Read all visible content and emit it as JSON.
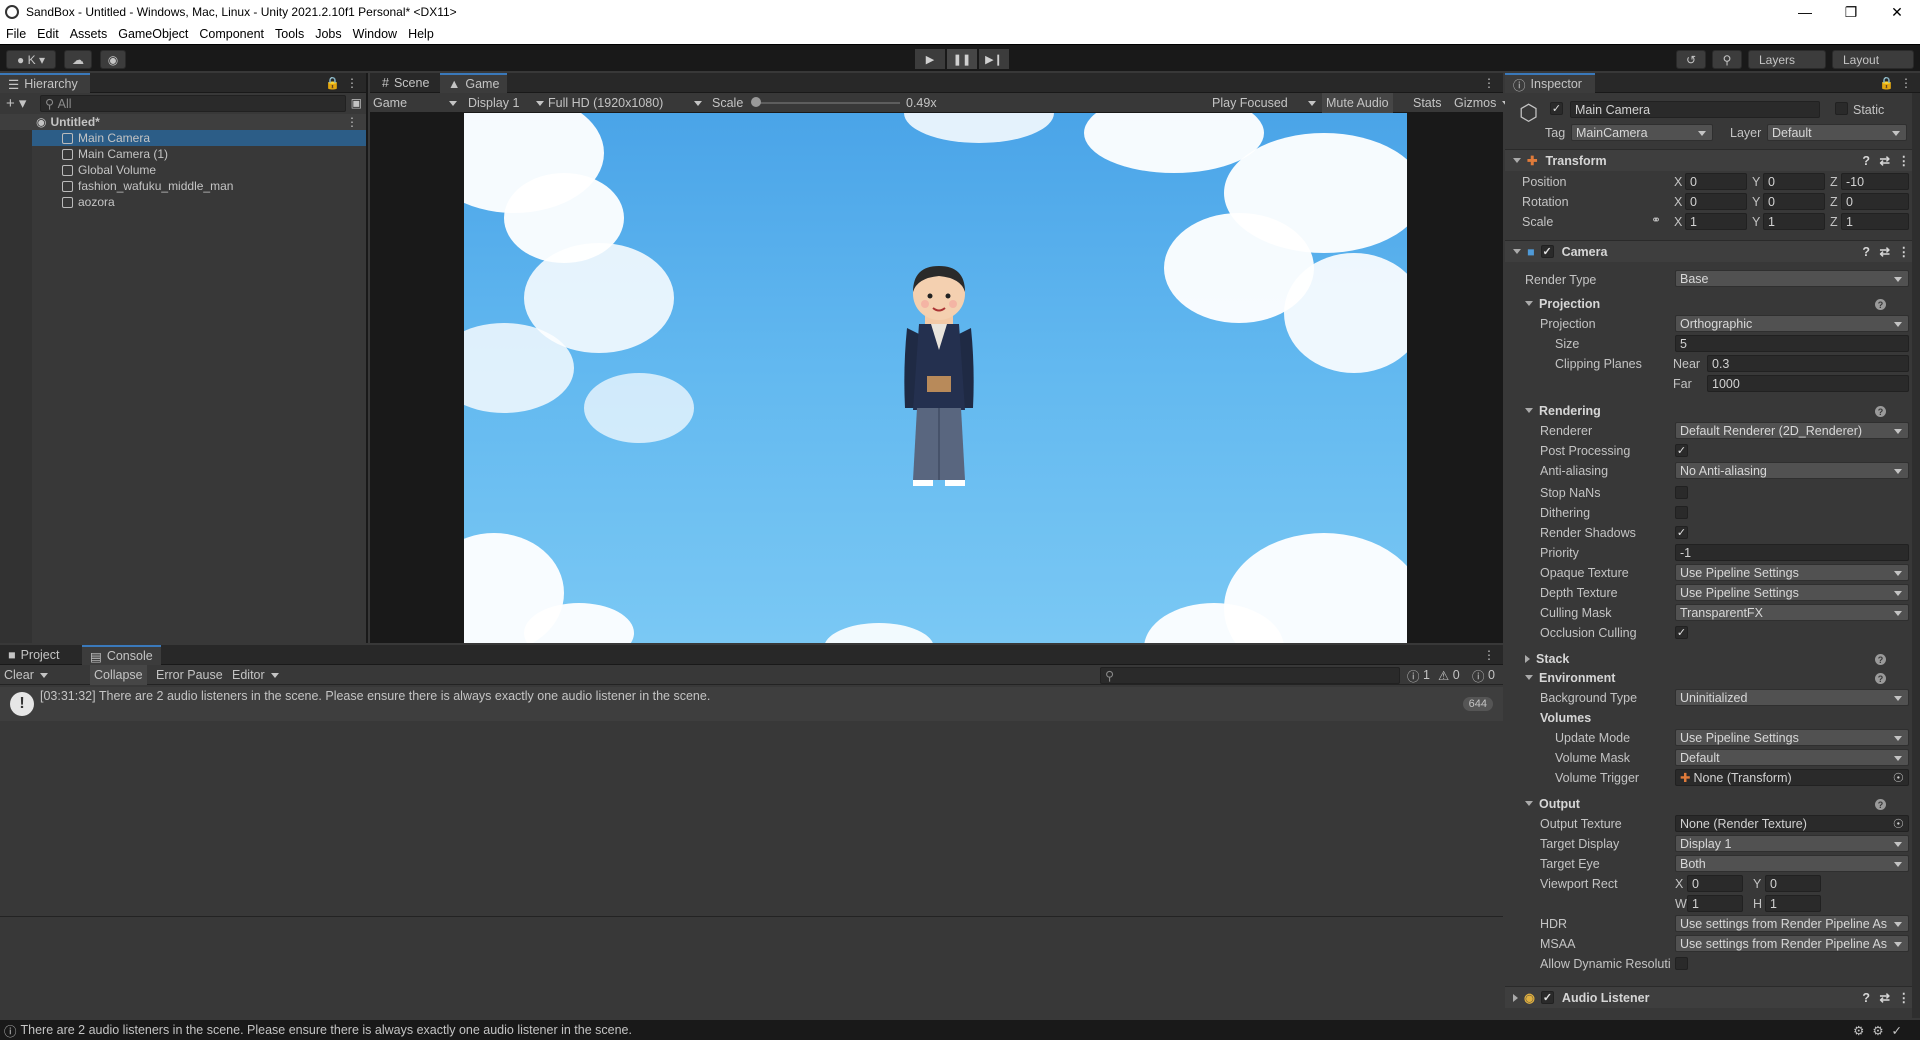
{
  "window": {
    "title": "SandBox - Untitled - Windows, Mac, Linux - Unity 2021.2.10f1 Personal* <DX11>"
  },
  "menu": [
    "File",
    "Edit",
    "Assets",
    "GameObject",
    "Component",
    "Tools",
    "Jobs",
    "Window",
    "Help"
  ],
  "toolbar": {
    "account": "K",
    "layers": "Layers",
    "layout": "Layout"
  },
  "hierarchy": {
    "tab": "Hierarchy",
    "search_placeholder": "All",
    "scene": "Untitled*",
    "items": [
      "Main Camera",
      "Main Camera (1)",
      "Global Volume",
      "fashion_wafuku_middle_man",
      "aozora"
    ]
  },
  "game_view": {
    "tabs": [
      "Scene",
      "Game"
    ],
    "view_mode": "Game",
    "display": "Display 1",
    "resolution": "Full HD (1920x1080)",
    "scale_label": "Scale",
    "scale_value": "0.49x",
    "play_mode": "Play Focused",
    "mute": "Mute Audio",
    "stats": "Stats",
    "gizmos": "Gizmos"
  },
  "console": {
    "tabs": [
      "Project",
      "Console"
    ],
    "buttons": [
      "Clear",
      "Collapse",
      "Error Pause",
      "Editor"
    ],
    "counts": {
      "warn_log": "1",
      "warnings": "0",
      "errors": "0"
    },
    "message": "[03:31:32] There are 2 audio listeners in the scene. Please ensure there is always exactly one audio listener in the scene.",
    "message_count": "644"
  },
  "status_bar": {
    "message": "There are 2 audio listeners in the scene. Please ensure there is always exactly one audio listener in the scene."
  },
  "inspector": {
    "tab": "Inspector",
    "object_name": "Main Camera",
    "static_label": "Static",
    "tag_label": "Tag",
    "tag": "MainCamera",
    "layer_label": "Layer",
    "layer": "Default",
    "transform": {
      "title": "Transform",
      "position_label": "Position",
      "position": [
        "0",
        "0",
        "-10"
      ],
      "rotation_label": "Rotation",
      "rotation": [
        "0",
        "0",
        "0"
      ],
      "scale_label": "Scale",
      "scale": [
        "1",
        "1",
        "1"
      ]
    },
    "camera": {
      "title": "Camera",
      "render_type_label": "Render Type",
      "render_type": "Base",
      "projection_section": "Projection",
      "projection_label": "Projection",
      "projection": "Orthographic",
      "size_label": "Size",
      "size": "5",
      "clipping_label": "Clipping Planes",
      "near_label": "Near",
      "near": "0.3",
      "far_label": "Far",
      "far": "1000",
      "rendering_section": "Rendering",
      "renderer_label": "Renderer",
      "renderer": "Default Renderer (2D_Renderer)",
      "post_processing_label": "Post Processing",
      "anti_aliasing_label": "Anti-aliasing",
      "anti_aliasing": "No Anti-aliasing",
      "stop_nans_label": "Stop NaNs",
      "dithering_label": "Dithering",
      "render_shadows_label": "Render Shadows",
      "priority_label": "Priority",
      "priority": "-1",
      "opaque_texture_label": "Opaque Texture",
      "opaque_texture": "Use Pipeline Settings",
      "depth_texture_label": "Depth Texture",
      "depth_texture": "Use Pipeline Settings",
      "culling_mask_label": "Culling Mask",
      "culling_mask": "TransparentFX",
      "occlusion_label": "Occlusion Culling",
      "stack_section": "Stack",
      "environment_section": "Environment",
      "background_type_label": "Background Type",
      "background_type": "Uninitialized",
      "volumes_label": "Volumes",
      "update_mode_label": "Update Mode",
      "update_mode": "Use Pipeline Settings",
      "volume_mask_label": "Volume Mask",
      "volume_mask": "Default",
      "volume_trigger_label": "Volume Trigger",
      "volume_trigger": "None (Transform)",
      "output_section": "Output",
      "output_texture_label": "Output Texture",
      "output_texture": "None (Render Texture)",
      "target_display_label": "Target Display",
      "target_display": "Display 1",
      "target_eye_label": "Target Eye",
      "target_eye": "Both",
      "viewport_label": "Viewport Rect",
      "viewport": {
        "x": "0",
        "y": "0",
        "w": "1",
        "h": "1"
      },
      "hdr_label": "HDR",
      "hdr": "Use settings from Render Pipeline As",
      "msaa_label": "MSAA",
      "msaa": "Use settings from Render Pipeline As",
      "dynamic_res_label": "Allow Dynamic Resoluti"
    },
    "audio_listener": {
      "title": "Audio Listener"
    }
  }
}
